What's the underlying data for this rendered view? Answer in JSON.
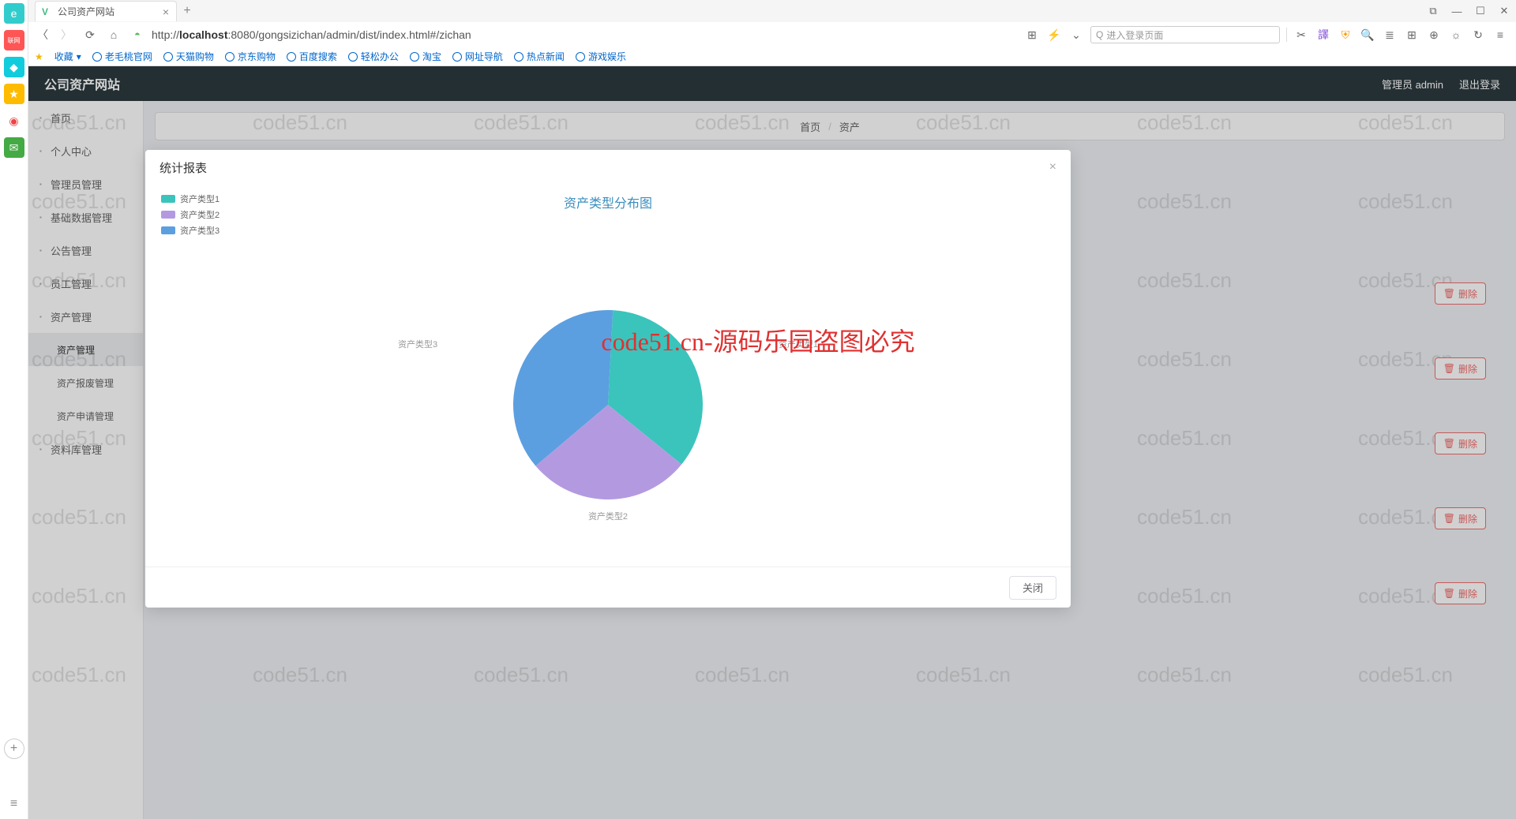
{
  "browser": {
    "tab_title": "公司资产网站",
    "url_prefix": "http://",
    "url_bold": "localhost",
    "url_rest": ":8080/gongsizichan/admin/dist/index.html#/zichan",
    "search_placeholder": "进入登录页面",
    "bookmarks": [
      "收藏",
      "老毛桃官网",
      "天猫购物",
      "京东购物",
      "百度搜索",
      "轻松办公",
      "淘宝",
      "网址导航",
      "热点新闻",
      "游戏娱乐"
    ]
  },
  "app": {
    "title": "公司资产网站",
    "user_label": "管理员 admin",
    "logout": "退出登录",
    "breadcrumb_home": "首页",
    "breadcrumb_current": "资产"
  },
  "sidebar": {
    "items": [
      {
        "label": "首页",
        "key": "home"
      },
      {
        "label": "个人中心",
        "key": "profile"
      },
      {
        "label": "管理员管理",
        "key": "admin"
      },
      {
        "label": "基础数据管理",
        "key": "basedata"
      },
      {
        "label": "公告管理",
        "key": "notice"
      },
      {
        "label": "员工管理",
        "key": "staff"
      },
      {
        "label": "资产管理",
        "key": "asset"
      },
      {
        "label": "资产管理",
        "key": "asset-sub",
        "sub": true,
        "active": true
      },
      {
        "label": "资产报废管理",
        "key": "scrap",
        "sub": true
      },
      {
        "label": "资产申请管理",
        "key": "apply",
        "sub": true
      },
      {
        "label": "资料库管理",
        "key": "lib"
      }
    ]
  },
  "modal": {
    "title": "统计报表",
    "close_label": "关闭"
  },
  "chart_data": {
    "type": "pie",
    "title": "资产类型分布图",
    "series": [
      {
        "name": "资产类型1",
        "value": 35,
        "color": "#3ac4bc"
      },
      {
        "name": "资产类型2",
        "value": 28,
        "color": "#b39ae0"
      },
      {
        "name": "资产类型3",
        "value": 37,
        "color": "#5b9fe0"
      }
    ],
    "legend_position": "top-left"
  },
  "ghost_buttons": {
    "delete": "删除"
  },
  "watermark": {
    "text": "code51.cn",
    "red_text": "code51.cn-源码乐园盗图必究"
  }
}
